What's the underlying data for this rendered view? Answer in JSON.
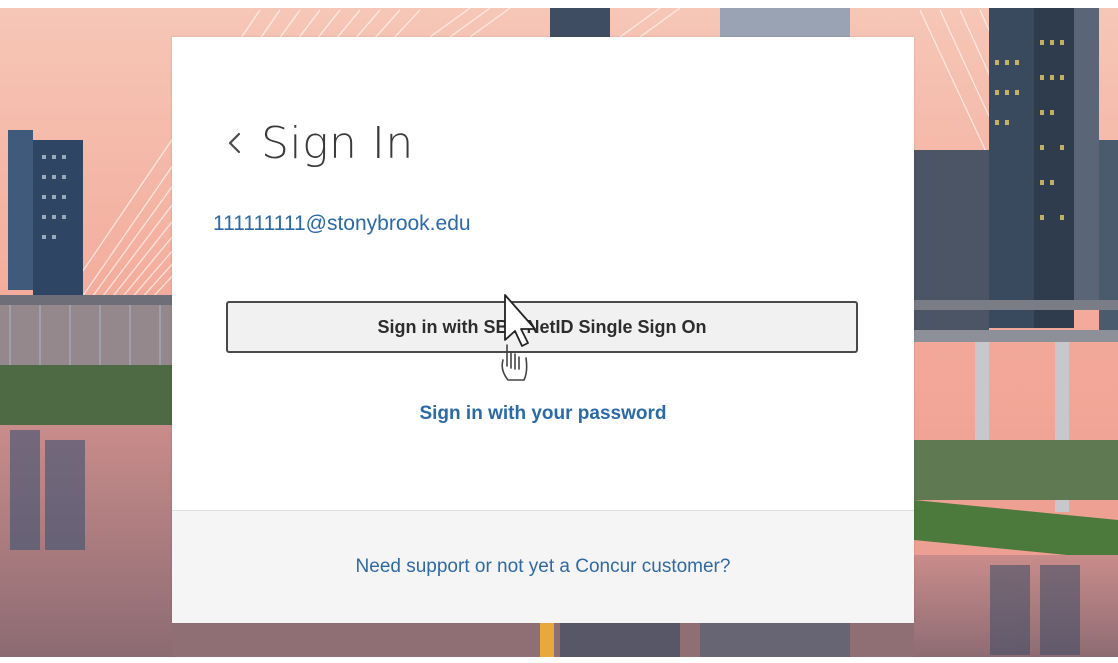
{
  "card": {
    "title": "Sign In",
    "email": "111111111@stonybrook.edu",
    "sso_button_label": "Sign in with SBU NetID Single Sign On",
    "password_link": "Sign in with your password",
    "support_link": "Need support or not yet a Concur customer?"
  },
  "icons": {
    "back": "chevron-left-icon",
    "cursor": "mouse-pointer-icon",
    "hand": "hand-pointer-icon"
  },
  "colors": {
    "link": "#2b6aa8",
    "button_bg": "#f1f1f1",
    "button_border": "#4a4a4a",
    "title": "#3a3a3a",
    "background_sky": "#f4b2a2"
  }
}
